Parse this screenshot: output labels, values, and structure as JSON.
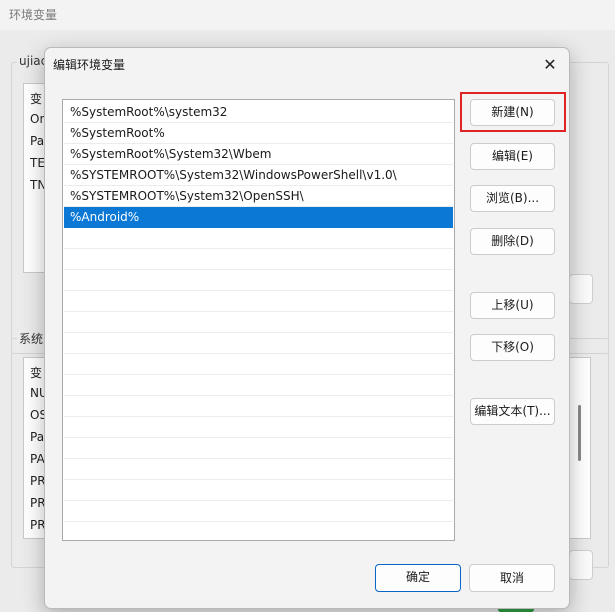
{
  "parent_window": {
    "title": "环境变量",
    "user_group_label": "ujiac",
    "user_list_rows": [
      "变",
      "On",
      "Pa",
      "TE",
      "TN"
    ],
    "system_group_label": "系统",
    "system_list_rows": [
      "变",
      "NU",
      "OS",
      "Pa",
      "PA",
      "PR",
      "PR",
      "PR"
    ]
  },
  "dialog": {
    "title": "编辑环境变量",
    "close_label": "✕",
    "path_entries": [
      {
        "value": "%SystemRoot%\\system32",
        "selected": false
      },
      {
        "value": "%SystemRoot%",
        "selected": false
      },
      {
        "value": "%SystemRoot%\\System32\\Wbem",
        "selected": false
      },
      {
        "value": "%SYSTEMROOT%\\System32\\WindowsPowerShell\\v1.0\\",
        "selected": false
      },
      {
        "value": "%SYSTEMROOT%\\System32\\OpenSSH\\",
        "selected": false
      },
      {
        "value": "%Android%",
        "selected": true
      }
    ],
    "buttons": {
      "new": "新建(N)",
      "edit": "编辑(E)",
      "browse": "浏览(B)...",
      "delete": "删除(D)",
      "move_up": "上移(U)",
      "move_down": "下移(O)",
      "edit_text": "编辑文本(T)...",
      "ok": "确定",
      "cancel": "取消"
    }
  },
  "colors": {
    "selection": "#0a78d4",
    "highlight_frame": "#e02424",
    "ok_border": "#0a64c8"
  }
}
